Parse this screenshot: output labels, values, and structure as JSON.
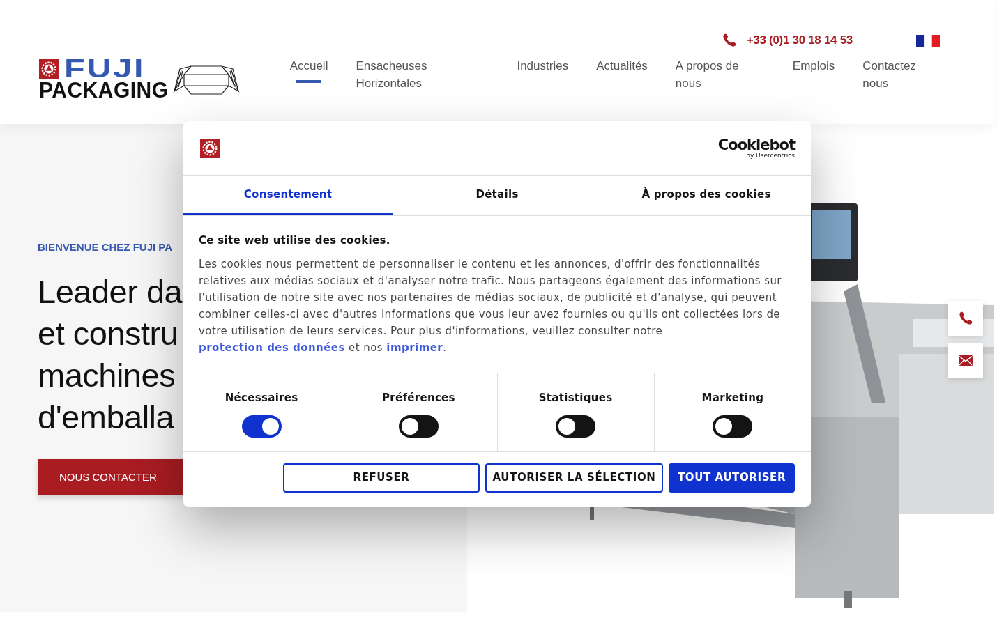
{
  "header": {
    "logo": {
      "word1": "FUJI",
      "word2": "PACKAGING"
    },
    "phone": "+33 (0)1 30 18 14 53",
    "nav": [
      {
        "label": "Accueil",
        "selected": true
      },
      {
        "label": "Ensacheuses Horizontales",
        "selected": false
      },
      {
        "label": "Industries",
        "selected": false
      },
      {
        "label": "Actualités",
        "selected": false
      },
      {
        "label": "A propos de nous",
        "selected": false
      },
      {
        "label": "Emplois",
        "selected": false
      },
      {
        "label": "Contactez nous",
        "selected": false
      }
    ]
  },
  "hero": {
    "eyebrow": "BIENVENUE CHEZ FUJI PA",
    "title_lines": [
      "Leader da",
      "et constru",
      "machines",
      "d'emballa"
    ],
    "button": "NOUS CONTACTER"
  },
  "cookie_dialog": {
    "brand": {
      "name": "Cookiebot",
      "tagline": "by Usercentrics"
    },
    "tabs": [
      {
        "label": "Consentement",
        "selected": true
      },
      {
        "label": "Détails",
        "selected": false
      },
      {
        "label": "À propos des cookies",
        "selected": false
      }
    ],
    "heading": "Ce site web utilise des cookies.",
    "body": {
      "text_1": "Les cookies nous permettent de personnaliser le contenu et les annonces, d'offrir des fonctionnalités relatives aux médias sociaux et d'analyser notre trafic. Nous partageons également des informations sur l'utilisation de notre site avec nos partenaires de médias sociaux, de publicité et d'analyse, qui peuvent combiner celles-ci avec d'autres informations que vous leur avez fournies ou qu'ils ont collectées lors de votre utilisation de leurs services. Pour plus d'informations, veuillez consulter notre",
      "link_1": "protection des données",
      "text_2": "et nos",
      "link_2": "imprimer",
      "text_3": "."
    },
    "categories": [
      {
        "label": "Nécessaires",
        "checked": true
      },
      {
        "label": "Préférences",
        "checked": false
      },
      {
        "label": "Statistiques",
        "checked": false
      },
      {
        "label": "Marketing",
        "checked": false
      }
    ],
    "buttons": [
      {
        "label": "REFUSER",
        "kind": "outline"
      },
      {
        "label": "AUTORISER LA SÉLECTION",
        "kind": "outline"
      },
      {
        "label": "TOUT AUTORISER",
        "kind": "primary"
      }
    ]
  }
}
